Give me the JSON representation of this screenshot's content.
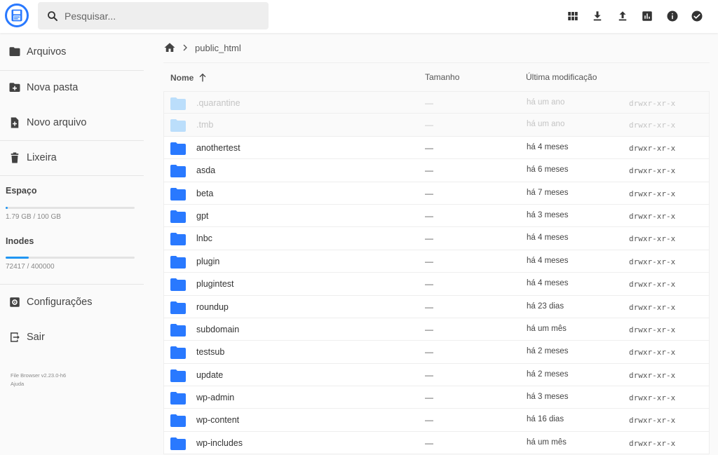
{
  "header": {
    "search_placeholder": "Pesquisar...",
    "actions": [
      "grid-view-icon",
      "download-icon",
      "upload-icon",
      "info-chart-icon",
      "info-icon",
      "select-icon"
    ]
  },
  "sidebar": {
    "items": [
      {
        "label": "Arquivos",
        "icon": "folder-icon"
      },
      {
        "label": "Nova pasta",
        "icon": "new-folder-icon"
      },
      {
        "label": "Novo arquivo",
        "icon": "new-file-icon"
      },
      {
        "label": "Lixeira",
        "icon": "trash-icon"
      }
    ],
    "quota": {
      "space_title": "Espaço",
      "space_text": "1.79 GB / 100 GB",
      "space_fraction": 0.0179,
      "inodes_title": "Inodes",
      "inodes_text": "72417 / 400000",
      "inodes_fraction": 0.181
    },
    "settings": {
      "label": "Configurações",
      "icon": "settings-icon"
    },
    "logout": {
      "label": "Sair",
      "icon": "logout-icon"
    },
    "credits": {
      "version": "File Browser v2.23.0-h6",
      "help": "Ajuda"
    }
  },
  "breadcrumb": {
    "home_icon": "home-icon",
    "path": "public_html"
  },
  "listing": {
    "columns": {
      "name": "Nome",
      "size": "Tamanho",
      "modified": "Última modificação"
    },
    "rows": [
      {
        "name": ".quarantine",
        "size": "—",
        "modified": "há um ano",
        "perm": "drwxr-xr-x",
        "dim": true
      },
      {
        "name": ".tmb",
        "size": "—",
        "modified": "há um ano",
        "perm": "drwxr-xr-x",
        "dim": true
      },
      {
        "name": "anothertest",
        "size": "—",
        "modified": "há 4 meses",
        "perm": "drwxr-xr-x",
        "dim": false
      },
      {
        "name": "asda",
        "size": "—",
        "modified": "há 6 meses",
        "perm": "drwxr-xr-x",
        "dim": false
      },
      {
        "name": "beta",
        "size": "—",
        "modified": "há 7 meses",
        "perm": "drwxr-xr-x",
        "dim": false
      },
      {
        "name": "gpt",
        "size": "—",
        "modified": "há 3 meses",
        "perm": "drwxr-xr-x",
        "dim": false
      },
      {
        "name": "lnbc",
        "size": "—",
        "modified": "há 4 meses",
        "perm": "drwxr-xr-x",
        "dim": false
      },
      {
        "name": "plugin",
        "size": "—",
        "modified": "há 4 meses",
        "perm": "drwxr-xr-x",
        "dim": false
      },
      {
        "name": "plugintest",
        "size": "—",
        "modified": "há 4 meses",
        "perm": "drwxr-xr-x",
        "dim": false
      },
      {
        "name": "roundup",
        "size": "—",
        "modified": "há 23 dias",
        "perm": "drwxr-xr-x",
        "dim": false
      },
      {
        "name": "subdomain",
        "size": "—",
        "modified": "há um mês",
        "perm": "drwxr-xr-x",
        "dim": false
      },
      {
        "name": "testsub",
        "size": "—",
        "modified": "há 2 meses",
        "perm": "drwxr-xr-x",
        "dim": false
      },
      {
        "name": "update",
        "size": "—",
        "modified": "há 2 meses",
        "perm": "drwxr-xr-x",
        "dim": false
      },
      {
        "name": "wp-admin",
        "size": "—",
        "modified": "há 3 meses",
        "perm": "drwxr-xr-x",
        "dim": false
      },
      {
        "name": "wp-content",
        "size": "—",
        "modified": "há 16 dias",
        "perm": "drwxr-xr-x",
        "dim": false
      },
      {
        "name": "wp-includes",
        "size": "—",
        "modified": "há um mês",
        "perm": "drwxr-xr-x",
        "dim": false
      }
    ]
  },
  "colors": {
    "accent": "#2196f3",
    "folder": "#2979ff",
    "folder_dim": "#bbdefb"
  }
}
